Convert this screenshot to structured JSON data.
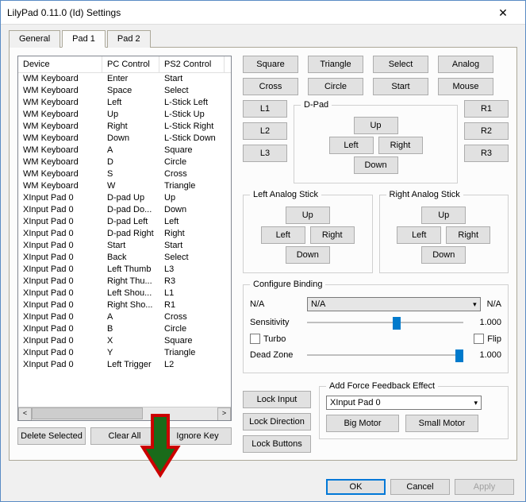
{
  "window": {
    "title": "LilyPad 0.11.0 (Id) Settings"
  },
  "tabs": [
    "General",
    "Pad 1",
    "Pad 2"
  ],
  "active_tab": 1,
  "list": {
    "headers": [
      "Device",
      "PC Control",
      "PS2 Control"
    ],
    "rows": [
      [
        "WM Keyboard",
        "Enter",
        "Start"
      ],
      [
        "WM Keyboard",
        "Space",
        "Select"
      ],
      [
        "WM Keyboard",
        "Left",
        "L-Stick Left"
      ],
      [
        "WM Keyboard",
        "Up",
        "L-Stick Up"
      ],
      [
        "WM Keyboard",
        "Right",
        "L-Stick Right"
      ],
      [
        "WM Keyboard",
        "Down",
        "L-Stick Down"
      ],
      [
        "WM Keyboard",
        "A",
        "Square"
      ],
      [
        "WM Keyboard",
        "D",
        "Circle"
      ],
      [
        "WM Keyboard",
        "S",
        "Cross"
      ],
      [
        "WM Keyboard",
        "W",
        "Triangle"
      ],
      [
        "XInput Pad 0",
        "D-pad Up",
        "Up"
      ],
      [
        "XInput Pad 0",
        "D-pad Do...",
        "Down"
      ],
      [
        "XInput Pad 0",
        "D-pad Left",
        "Left"
      ],
      [
        "XInput Pad 0",
        "D-pad Right",
        "Right"
      ],
      [
        "XInput Pad 0",
        "Start",
        "Start"
      ],
      [
        "XInput Pad 0",
        "Back",
        "Select"
      ],
      [
        "XInput Pad 0",
        "Left Thumb",
        "L3"
      ],
      [
        "XInput Pad 0",
        "Right Thu...",
        "R3"
      ],
      [
        "XInput Pad 0",
        "Left Shou...",
        "L1"
      ],
      [
        "XInput Pad 0",
        "Right Sho...",
        "R1"
      ],
      [
        "XInput Pad 0",
        "A",
        "Cross"
      ],
      [
        "XInput Pad 0",
        "B",
        "Circle"
      ],
      [
        "XInput Pad 0",
        "X",
        "Square"
      ],
      [
        "XInput Pad 0",
        "Y",
        "Triangle"
      ],
      [
        "XInput Pad 0",
        "Left Trigger",
        "L2"
      ]
    ]
  },
  "left_buttons": {
    "delete": "Delete Selected",
    "clear": "Clear All",
    "ignore": "Ignore Key"
  },
  "face": {
    "square": "Square",
    "triangle": "Triangle",
    "select": "Select",
    "analog": "Analog",
    "cross": "Cross",
    "circle": "Circle",
    "start": "Start",
    "mouse": "Mouse"
  },
  "shoulders": {
    "l1": "L1",
    "l2": "L2",
    "l3": "L3",
    "r1": "R1",
    "r2": "R2",
    "r3": "R3"
  },
  "dpad": {
    "legend": "D-Pad",
    "up": "Up",
    "down": "Down",
    "left": "Left",
    "right": "Right"
  },
  "sticks": {
    "left": {
      "legend": "Left Analog Stick",
      "up": "Up",
      "down": "Down",
      "left": "Left",
      "right": "Right"
    },
    "right": {
      "legend": "Right Analog Stick",
      "up": "Up",
      "down": "Down",
      "left": "Left",
      "right": "Right"
    }
  },
  "cfg": {
    "legend": "Configure Binding",
    "na": "N/A",
    "sensitivity_label": "Sensitivity",
    "sensitivity_value": "1.000",
    "turbo": "Turbo",
    "flip": "Flip",
    "deadzone_label": "Dead Zone",
    "deadzone_value": "1.000"
  },
  "locks": {
    "input": "Lock Input",
    "direction": "Lock Direction",
    "buttons": "Lock Buttons"
  },
  "ff": {
    "legend": "Add Force Feedback Effect",
    "device": "XInput Pad 0",
    "big": "Big Motor",
    "small": "Small Motor"
  },
  "dlg": {
    "ok": "OK",
    "cancel": "Cancel",
    "apply": "Apply"
  }
}
